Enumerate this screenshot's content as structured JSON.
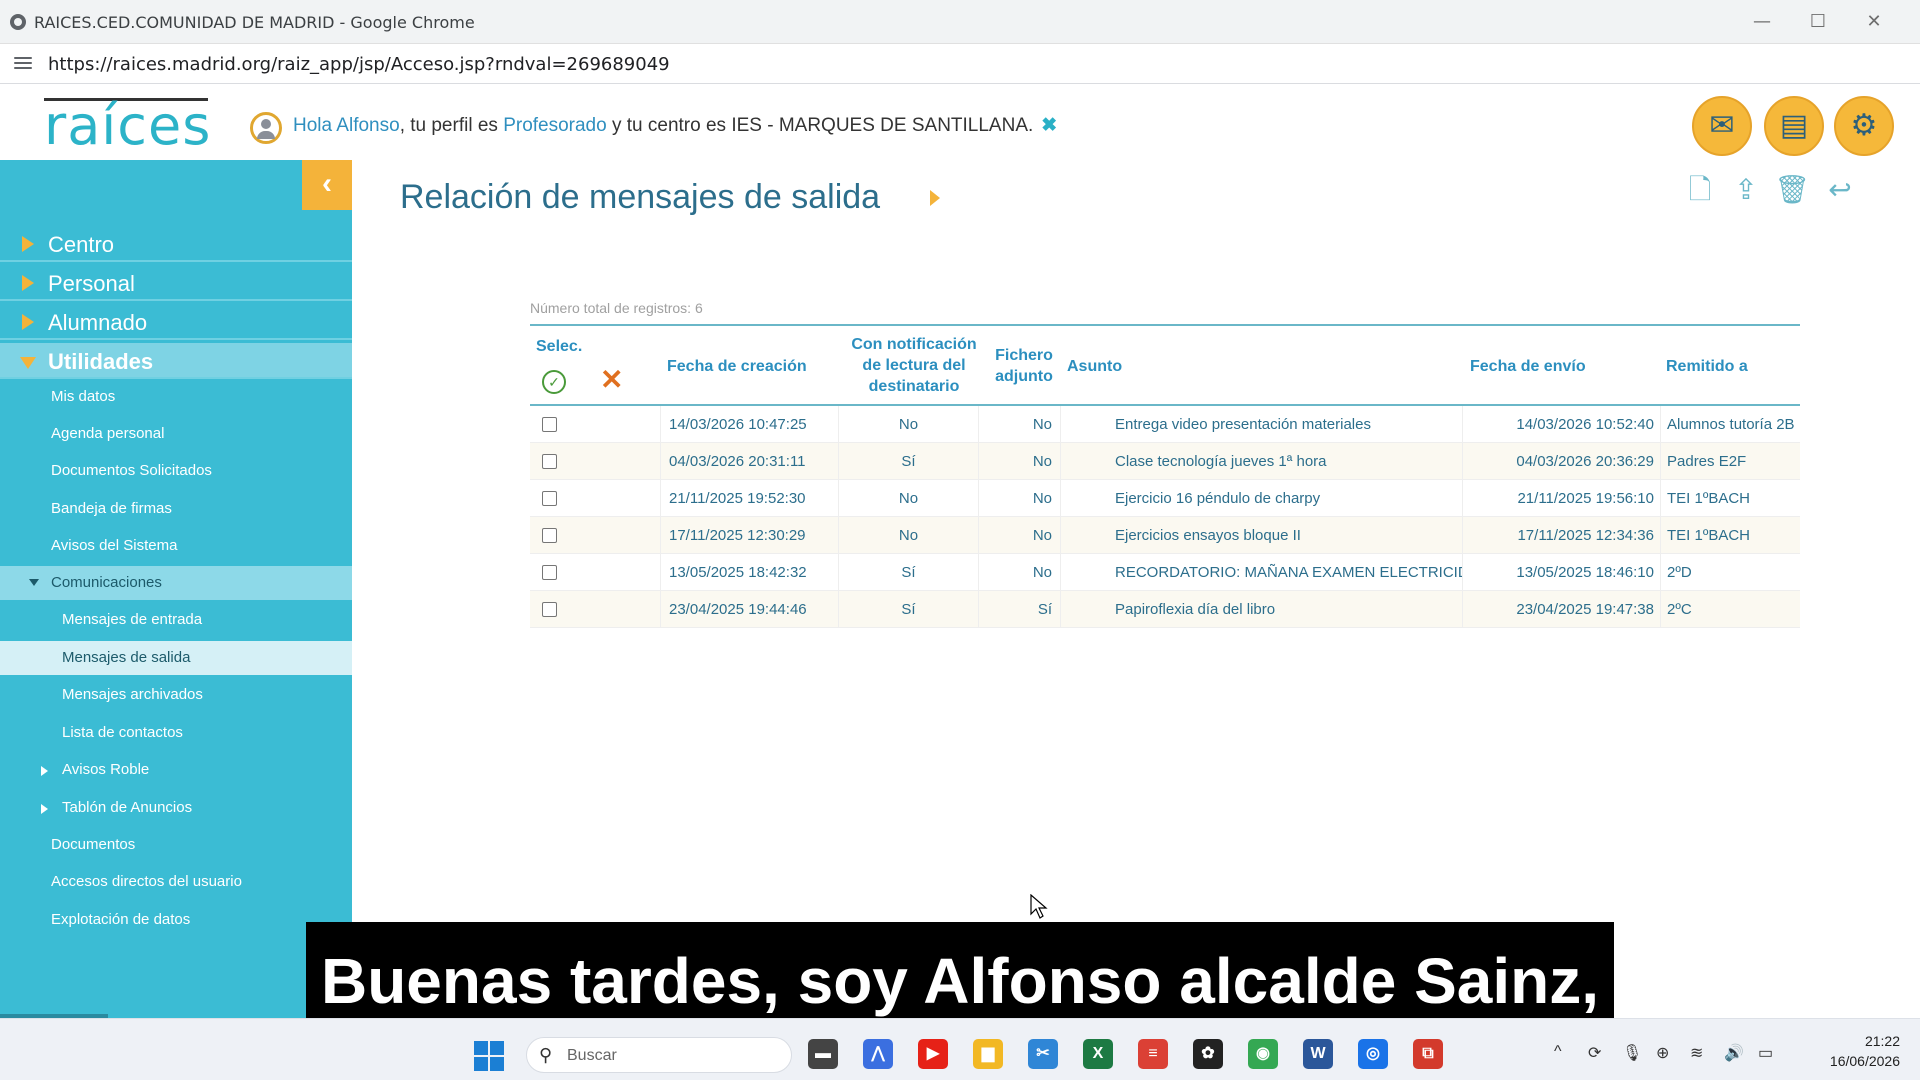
{
  "window": {
    "title": "RAICES.CED.COMUNIDAD DE MADRID - Google Chrome",
    "minimize": "—",
    "maximize": "☐",
    "close": "✕"
  },
  "browser": {
    "url": "https://raices.madrid.org/raiz_app/jsp/Acceso.jsp?rndval=269689049"
  },
  "header": {
    "logo": "raíces",
    "greeting_prefix": "Hola Alfonso",
    "greeting_mid1": ", tu perfil es ",
    "profile": "Profesorado",
    "greeting_mid2": " y tu centro es IES - MARQUES DE SANTILLANA.",
    "close_mark": "✖",
    "icons": [
      "mail-icon",
      "documents-icon",
      "settings-icon"
    ]
  },
  "sidebar": {
    "collapse_glyph": "‹",
    "top_items": [
      {
        "label": "Centro"
      },
      {
        "label": "Personal"
      },
      {
        "label": "Alumnado"
      },
      {
        "label": "Utilidades"
      }
    ],
    "sub_items": [
      {
        "label": "Mis datos"
      },
      {
        "label": "Agenda personal"
      },
      {
        "label": "Documentos Solicitados"
      },
      {
        "label": "Bandeja de firmas"
      },
      {
        "label": "Avisos del Sistema"
      },
      {
        "label": "Comunicaciones"
      },
      {
        "label": "Mensajes de entrada"
      },
      {
        "label": "Mensajes de salida"
      },
      {
        "label": "Mensajes archivados"
      },
      {
        "label": "Lista de contactos"
      },
      {
        "label": "Avisos Roble"
      },
      {
        "label": "Tablón de Anuncios"
      },
      {
        "label": "Documentos"
      },
      {
        "label": "Accesos directos del usuario"
      },
      {
        "label": "Explotación de datos"
      }
    ]
  },
  "main": {
    "title": "Relación de mensajes de salida",
    "toolbar_icons": [
      "new-message-icon",
      "export-icon",
      "trash-icon",
      "reply-icon"
    ],
    "total_records": "Número total de registros: 6",
    "columns": {
      "select": "Selec.",
      "created": "Fecha de creación",
      "read_notice_1": "Con notificación",
      "read_notice_2": "de lectura del",
      "read_notice_3": "destinatario",
      "attachment_1": "Fichero",
      "attachment_2": "adjunto",
      "subject": "Asunto",
      "sent": "Fecha de envío",
      "recipient": "Remitido a"
    },
    "check_all_glyph": "✓",
    "uncheck_all_glyph": "✕",
    "rows": [
      {
        "created": "14/03/2026 10:47:25",
        "notify": "No",
        "attach": "No",
        "subject": "Entrega video presentación materiales",
        "sent": "14/03/2026 10:52:40",
        "to": "Alumnos tutoría 2B"
      },
      {
        "created": "04/03/2026 20:31:11",
        "notify": "Sí",
        "attach": "No",
        "subject": "Clase tecnología jueves 1ª hora",
        "sent": "04/03/2026 20:36:29",
        "to": "Padres E2F"
      },
      {
        "created": "21/11/2025 19:52:30",
        "notify": "No",
        "attach": "No",
        "subject": "Ejercicio 16 péndulo de charpy",
        "sent": "21/11/2025 19:56:10",
        "to": "TEI 1ºBACH"
      },
      {
        "created": "17/11/2025 12:30:29",
        "notify": "No",
        "attach": "No",
        "subject": "Ejercicios ensayos bloque II",
        "sent": "17/11/2025 12:34:36",
        "to": "TEI 1ºBACH"
      },
      {
        "created": "13/05/2025 18:42:32",
        "notify": "Sí",
        "attach": "No",
        "subject": "RECORDATORIO: MAÑANA EXAMEN ELECTRICIDAD",
        "sent": "13/05/2025 18:46:10",
        "to": "2ºD"
      },
      {
        "created": "23/04/2025 19:44:46",
        "notify": "Sí",
        "attach": "Sí",
        "subject": "Papiroflexia día del libro",
        "sent": "23/04/2025 19:47:38",
        "to": "2ºC"
      }
    ]
  },
  "caption": "Buenas tardes, soy Alfonso alcalde Sainz,",
  "taskbar": {
    "search_placeholder": "Buscar",
    "search_glyph": "⚲",
    "apps": [
      {
        "name": "file-explorer-icon",
        "glyph": "▬",
        "color": "#444444"
      },
      {
        "name": "copilot-icon",
        "glyph": "⋀",
        "color": "#3b6fe0"
      },
      {
        "name": "youtube-icon",
        "glyph": "▶",
        "color": "#e62117"
      },
      {
        "name": "folder-icon",
        "glyph": "▆",
        "color": "#f2b824"
      },
      {
        "name": "snipping-icon",
        "glyph": "✂",
        "color": "#2f86d6"
      },
      {
        "name": "excel-icon",
        "glyph": "X",
        "color": "#1d7a43"
      },
      {
        "name": "todoist-icon",
        "glyph": "≡",
        "color": "#db4035"
      },
      {
        "name": "chatgpt-icon",
        "glyph": "✿",
        "color": "#222222"
      },
      {
        "name": "chrome-icon",
        "glyph": "◉",
        "color": "#34a853"
      },
      {
        "name": "word-icon",
        "glyph": "W",
        "color": "#2b579a"
      },
      {
        "name": "chrome-profile-icon",
        "glyph": "◎",
        "color": "#1a73e8"
      },
      {
        "name": "pdf-icon",
        "glyph": "⧉",
        "color": "#d33a2c"
      }
    ],
    "tray_glyphs": [
      "^",
      "⟳",
      "🎙",
      "⊕",
      "≋",
      "🔊",
      "▭"
    ],
    "time": "21:22",
    "date": "16/06/2026"
  }
}
